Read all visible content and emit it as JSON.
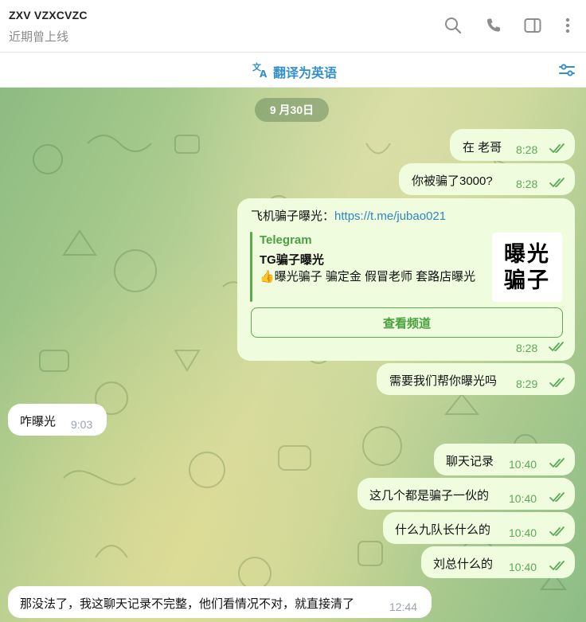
{
  "header": {
    "title": "ZXV VZXCVZC",
    "status": "近期曾上线",
    "icons": [
      "search-icon",
      "phone-icon",
      "sidebar-toggle-icon",
      "more-vert-icon"
    ]
  },
  "translate_bar": {
    "label": "翻译为英语",
    "icon": "translate-icon",
    "right_icon": "filter-icon"
  },
  "chat": {
    "date": "9 月30日",
    "messages": [
      {
        "side": "out",
        "text": "在 老哥",
        "time": "8:28"
      },
      {
        "side": "out",
        "text": "你被骗了3000?",
        "time": "8:28"
      },
      {
        "side": "out",
        "text_prefix": "飞机骗子曝光：",
        "link": "https://t.me/jubao021",
        "time": "8:28",
        "preview": {
          "site": "Telegram",
          "title": "TG骗子曝光",
          "description": "👍曝光骗子  骗定金  假冒老师  套路店曝光",
          "thumbnail_text": "曝光\n骗子",
          "button": "查看频道"
        }
      },
      {
        "side": "out",
        "text": "需要我们帮你曝光吗",
        "time": "8:29"
      },
      {
        "side": "in",
        "text": "咋曝光",
        "time": "9:03"
      },
      {
        "side": "out",
        "text": "聊天记录",
        "time": "10:40"
      },
      {
        "side": "out",
        "text": "这几个都是骗子一伙的",
        "time": "10:40"
      },
      {
        "side": "out",
        "text": "什么九队长什么的",
        "time": "10:40"
      },
      {
        "side": "out",
        "text": "刘总什么的",
        "time": "10:40"
      },
      {
        "side": "in",
        "text": "那没法了，我这聊天记录不完整，他们看情况不对，就直接清了",
        "time": "12:44"
      }
    ]
  },
  "colors": {
    "outgoing_bubble": "#effdde",
    "incoming_bubble": "#ffffff",
    "accent_blue": "#3390c8",
    "accent_green": "#5ca94f"
  }
}
